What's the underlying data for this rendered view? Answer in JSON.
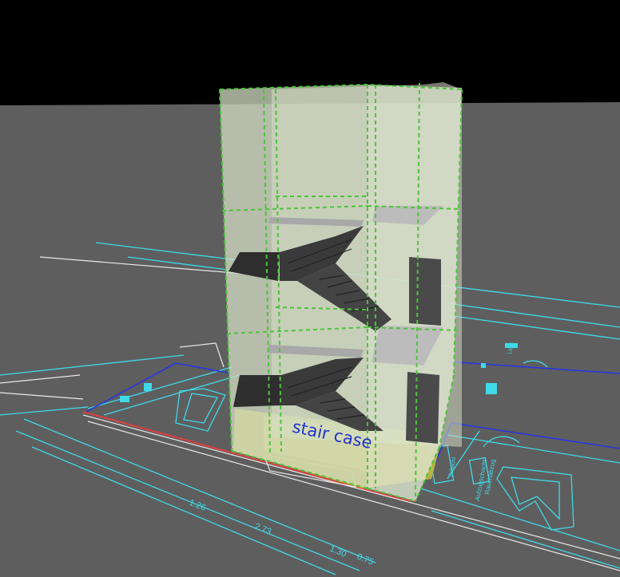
{
  "viewport": {
    "room_label": "stair case",
    "dimensions": [
      "1.26",
      "2.73",
      "1.30",
      "0.75"
    ],
    "side_labels": [
      "Aufzugschacht",
      "Rauchabzug",
      "Schacht",
      "Licht"
    ],
    "colors": {
      "sky": "#000000",
      "ground": "#5e5e5e",
      "cad_cyan": "#3fd9e8",
      "cad_blue": "#2a36e0",
      "cad_red": "#e04040",
      "cad_white": "#e8e8e8",
      "glass": "#d4ddc4",
      "glass_edge": "#4cc43c",
      "floor_zone": "#c8c040",
      "stair_dark": "#2e2e2e",
      "room_text": "#2233cc"
    }
  }
}
